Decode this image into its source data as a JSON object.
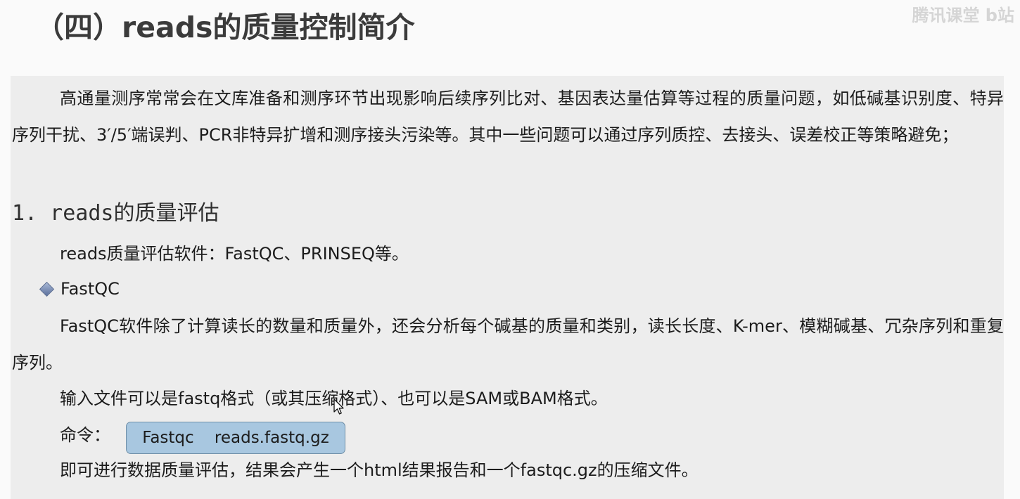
{
  "slide": {
    "title": "（四）reads的质量控制简介",
    "watermark": "腾讯课堂 b站"
  },
  "intro": {
    "paragraph": "高通量测序常常会在文库准备和测序环节出现影响后续序列比对、基因表达量估算等过程的质量问题，如低碱基识别度、特异序列干扰、3′/5′端误判、PCR非特异扩增和测序接头污染等。其中一些问题可以通过序列质控、去接头、误差校正等策略避免；"
  },
  "section1": {
    "heading": "1. reads的质量评估",
    "tools_line": "reads质量评估软件：FastQC、PRINSEQ等。",
    "bullet_label": "FastQC",
    "fastqc_paragraph": "FastQC软件除了计算读长的数量和质量外，还会分析每个碱基的质量和类别，读长长度、K-mer、模糊碱基、冗杂序列和重复序列。",
    "input_line": "输入文件可以是fastq格式（或其压缩格式）、也可以是SAM或BAM格式。",
    "command_label": "命令：",
    "command_text": "Fastqc    reads.fastq.gz",
    "result_line": "即可进行数据质量评估，结果会产生一个html结果报告和一个fastqc.gz的压缩文件。"
  },
  "icons": {
    "bullet": "diamond-bullet-icon",
    "cursor": "mouse-pointer-icon"
  },
  "colors": {
    "panel_background": "#ededed",
    "command_box": "#a8c7e0",
    "title": "#3b3b3b"
  }
}
